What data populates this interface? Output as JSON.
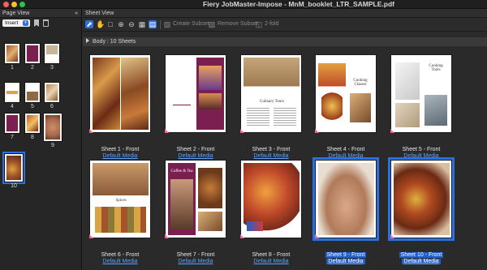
{
  "window": {
    "title": "Fiery JobMaster-Impose - MnM_booklet_LTR_SAMPLE.pdf"
  },
  "page_view": {
    "title": "Page View",
    "insert_label": "Insert",
    "pages": [
      "1",
      "2",
      "3",
      "4",
      "5",
      "6",
      "7",
      "8",
      "9",
      "10"
    ]
  },
  "sheet_view": {
    "title": "Sheet View",
    "toolbar": {
      "create_subset": "Create Subset",
      "remove_subset": "Remove Subset",
      "two_fold": "2-fold"
    },
    "section": "Body : 10 Sheets",
    "sheets": [
      {
        "label": "Sheet 1 - Front",
        "media": "Default Media"
      },
      {
        "label": "Sheet 2 - Front",
        "media": "Default Media"
      },
      {
        "label": "Sheet 3 - Front",
        "media": "Default Media"
      },
      {
        "label": "Sheet 4 - Front",
        "media": "Default Media"
      },
      {
        "label": "Sheet 5 - Front",
        "media": "Default Media"
      },
      {
        "label": "Sheet 6 - Front",
        "media": "Default Media"
      },
      {
        "label": "Sheet 7 - Front",
        "media": "Default Media"
      },
      {
        "label": "Sheet 8 - Front",
        "media": "Default Media"
      },
      {
        "label": "Sheet 9 - Front",
        "media": "Default Media"
      },
      {
        "label": "Sheet 10 - Front",
        "media": "Default Media"
      }
    ],
    "page_text": {
      "culinary_tours": "Culinary Tours",
      "cooking_classes": "Cooking Classes",
      "cooking_tools": "Cooking Tools",
      "spices": "Spices",
      "coffee_tea": "Coffee & Tea"
    }
  },
  "colors": {
    "accent": "#2c6fe0",
    "marker": "#ff5f9e",
    "magenta_page": "#7a1f4f"
  }
}
